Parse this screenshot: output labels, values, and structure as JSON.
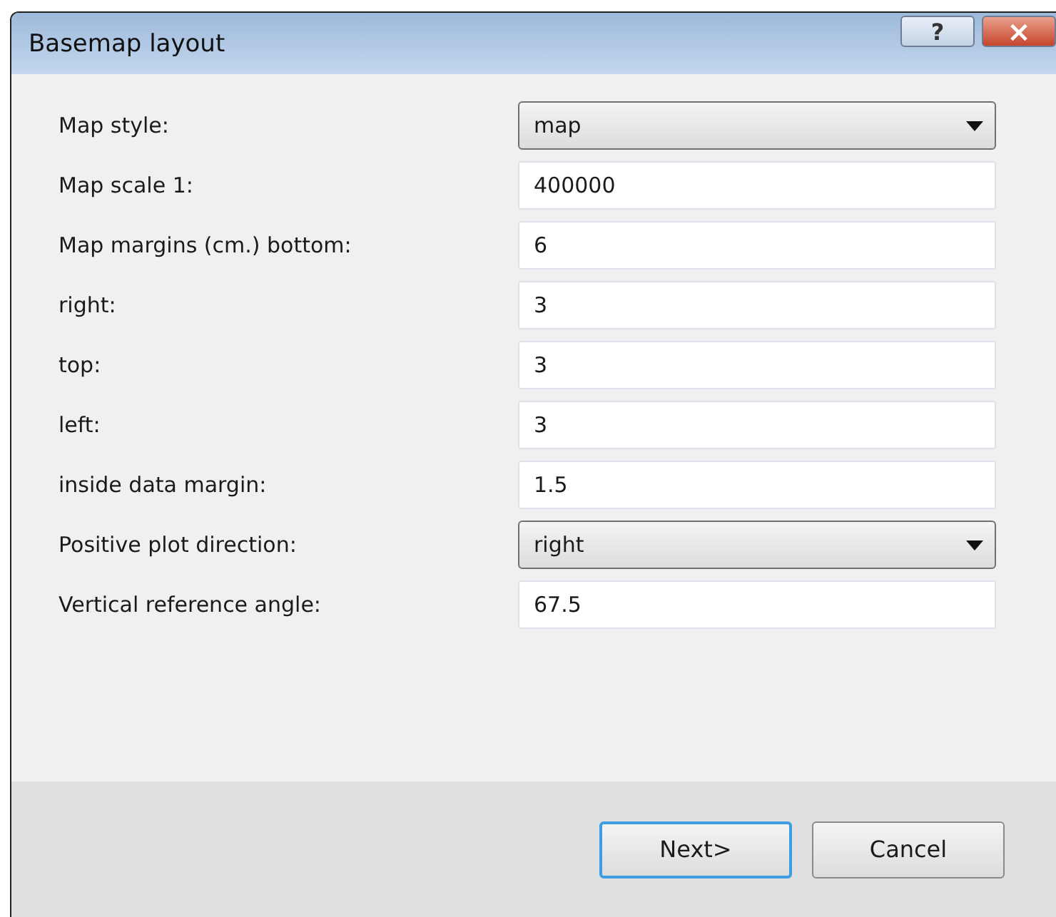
{
  "window": {
    "title": "Basemap layout",
    "controls": [
      {
        "kind": "help",
        "label": "?"
      },
      {
        "kind": "close",
        "label": "×"
      }
    ]
  },
  "fields": [
    {
      "label": "Map style:",
      "kind": "dropdown",
      "value": "map"
    },
    {
      "label": "Map scale 1:",
      "kind": "text",
      "value": "400000"
    },
    {
      "label": "Map margins (cm.) bottom:",
      "kind": "text",
      "value": "6"
    },
    {
      "label": "right:",
      "kind": "text",
      "value": "3"
    },
    {
      "label": "top:",
      "kind": "text",
      "value": "3"
    },
    {
      "label": "left:",
      "kind": "text",
      "value": "3"
    },
    {
      "label": "inside data margin:",
      "kind": "text",
      "value": "1.5"
    },
    {
      "label": "Positive plot direction:",
      "kind": "dropdown",
      "value": "right"
    },
    {
      "label": "Vertical reference angle:",
      "kind": "text",
      "value": "67.5"
    }
  ],
  "buttons": [
    {
      "label": "Next>",
      "default": true
    },
    {
      "label": "Cancel",
      "default": false
    }
  ]
}
